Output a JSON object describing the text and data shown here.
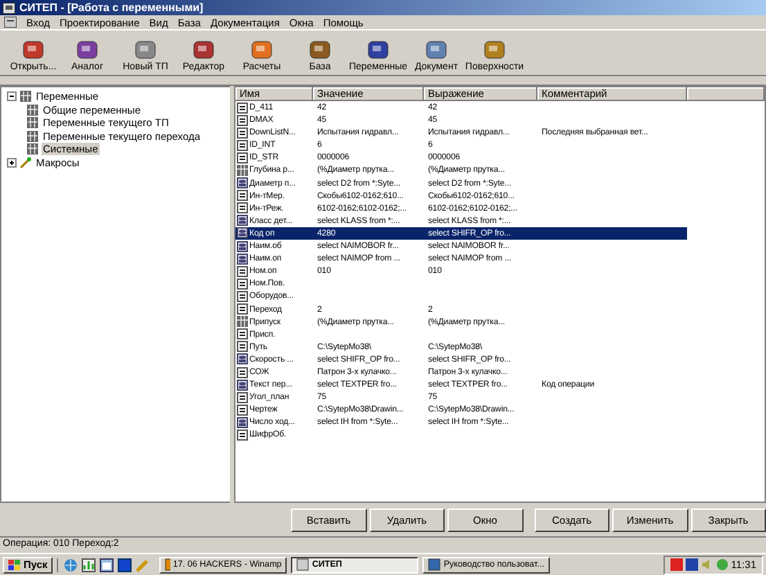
{
  "window": {
    "title": "СИТЕП - [Работа с переменными]"
  },
  "menu": [
    "Вход",
    "Проектирование",
    "Вид",
    "База",
    "Документация",
    "Окна",
    "Помощь"
  ],
  "toolbar": [
    {
      "label": "Открыть..."
    },
    {
      "label": "Аналог"
    },
    {
      "label": "Новый ТП"
    },
    {
      "label": "Редактор"
    },
    {
      "label": "Расчеты"
    },
    {
      "label": "База"
    },
    {
      "label": "Переменные"
    },
    {
      "label": "Документ"
    },
    {
      "label": "Поверхности"
    }
  ],
  "tree": [
    {
      "label": "Переменные",
      "expanded": true,
      "selected": false,
      "kind": "folder",
      "children": [
        {
          "label": "Общие переменные",
          "selected": false,
          "kind": "table"
        },
        {
          "label": "Переменные текущего ТП",
          "selected": false,
          "kind": "table"
        },
        {
          "label": "Переменные текущего перехода",
          "selected": false,
          "kind": "table"
        },
        {
          "label": "Системные",
          "selected": true,
          "kind": "table"
        }
      ]
    },
    {
      "label": "Макросы",
      "expanded": false,
      "selected": false,
      "kind": "macro"
    }
  ],
  "table": {
    "columns": [
      "Имя",
      "Значение",
      "Выражение",
      "Комментарий"
    ],
    "rows": [
      {
        "kind": "var",
        "selected": false,
        "cells": [
          "D_411",
          "42",
          "42",
          ""
        ]
      },
      {
        "kind": "var",
        "selected": false,
        "cells": [
          "DMAX",
          "45",
          "45",
          ""
        ]
      },
      {
        "kind": "var",
        "selected": false,
        "cells": [
          "DownListN...",
          "Испытания гидравл...",
          "Испытания гидравл...",
          "Последняя выбранная вет..."
        ]
      },
      {
        "kind": "var",
        "selected": false,
        "cells": [
          "ID_INT",
          "6",
          "6",
          ""
        ]
      },
      {
        "kind": "var",
        "selected": false,
        "cells": [
          "ID_STR",
          "0000006",
          "0000006",
          ""
        ]
      },
      {
        "kind": "table",
        "selected": false,
        "cells": [
          "Глубина р...",
          "(%Диаметр прутка...",
          "(%Диаметр прутка...",
          ""
        ]
      },
      {
        "kind": "sql",
        "selected": false,
        "cells": [
          "Диаметр п...",
          "select D2  from *:Syte...",
          "select D2  from *:Syte...",
          ""
        ]
      },
      {
        "kind": "var",
        "selected": false,
        "cells": [
          "Ин-тМер.",
          "Скобы6102-0162;610...",
          "Скобы6102-0162;610...",
          ""
        ]
      },
      {
        "kind": "var",
        "selected": false,
        "cells": [
          "Ин-тРеж.",
          "6102-0162;6102-0162;...",
          "6102-0162;6102-0162;...",
          ""
        ]
      },
      {
        "kind": "sql",
        "selected": false,
        "cells": [
          "Класс дет...",
          "select KLASS from *:...",
          "select KLASS from *:...",
          ""
        ]
      },
      {
        "kind": "sql",
        "selected": true,
        "cells": [
          "Код оп",
          "4280",
          "select SHIFR_OP  fro...",
          ""
        ]
      },
      {
        "kind": "sql",
        "selected": false,
        "cells": [
          "Наим.об",
          "select NAIMOBOR  fr...",
          "select NAIMOBOR  fr...",
          ""
        ]
      },
      {
        "kind": "sql",
        "selected": false,
        "cells": [
          "Наим.оп",
          "select NAIMOP  from ...",
          "select NAIMOP  from ...",
          ""
        ]
      },
      {
        "kind": "var",
        "selected": false,
        "cells": [
          "Ном.оп",
          "010",
          "010",
          ""
        ]
      },
      {
        "kind": "var",
        "selected": false,
        "cells": [
          "Ном.Пов.",
          "",
          "",
          ""
        ]
      },
      {
        "kind": "var",
        "selected": false,
        "cells": [
          "Оборудов...",
          "",
          "",
          ""
        ]
      },
      {
        "kind": "var",
        "selected": false,
        "cells": [
          "Переход",
          "2",
          "2",
          ""
        ]
      },
      {
        "kind": "table",
        "selected": false,
        "cells": [
          "Припуск",
          "(%Диаметр прутка...",
          "(%Диаметр прутка...",
          ""
        ]
      },
      {
        "kind": "var",
        "selected": false,
        "cells": [
          "Присп.",
          "",
          "",
          ""
        ]
      },
      {
        "kind": "var",
        "selected": false,
        "cells": [
          "Путь",
          "C:\\SytepMo38\\",
          "C:\\SytepMo38\\",
          ""
        ]
      },
      {
        "kind": "sql",
        "selected": false,
        "cells": [
          "Скорость ...",
          "select SHIFR_OP  fro...",
          "select SHIFR_OP  fro...",
          ""
        ]
      },
      {
        "kind": "var",
        "selected": false,
        "cells": [
          "СОЖ",
          "Патрон 3-х кулачко...",
          "Патрон 3-х кулачко...",
          ""
        ]
      },
      {
        "kind": "sql",
        "selected": false,
        "cells": [
          "Текст пер...",
          "select TEXTPER  fro...",
          "select TEXTPER  fro...",
          "Код операции"
        ]
      },
      {
        "kind": "var",
        "selected": false,
        "cells": [
          "Угол_план",
          "75",
          "75",
          ""
        ]
      },
      {
        "kind": "var",
        "selected": false,
        "cells": [
          "Чертеж",
          "C:\\SytepMo38\\Drawin...",
          "C:\\SytepMo38\\Drawin...",
          ""
        ]
      },
      {
        "kind": "sql",
        "selected": false,
        "cells": [
          "Число ход...",
          "select IH  from *:Syte...",
          "select IH  from *:Syte...",
          ""
        ]
      },
      {
        "kind": "var",
        "selected": false,
        "cells": [
          "ШифрОб.",
          "",
          "",
          ""
        ]
      }
    ]
  },
  "buttons": [
    "Вставить",
    "Удалить",
    "Окно",
    "Создать",
    "Изменить",
    "Закрыть"
  ],
  "status_bar": "Операция: 010 Переход:2",
  "taskbar": {
    "start": "Пуск",
    "tasks": [
      {
        "label": "17. 06 HACKERS - Winamp",
        "selected": false
      },
      {
        "label": "СИТЕП",
        "selected": true
      },
      {
        "label": "Руководство пользоват...",
        "selected": false
      }
    ],
    "clock": "11:31"
  }
}
